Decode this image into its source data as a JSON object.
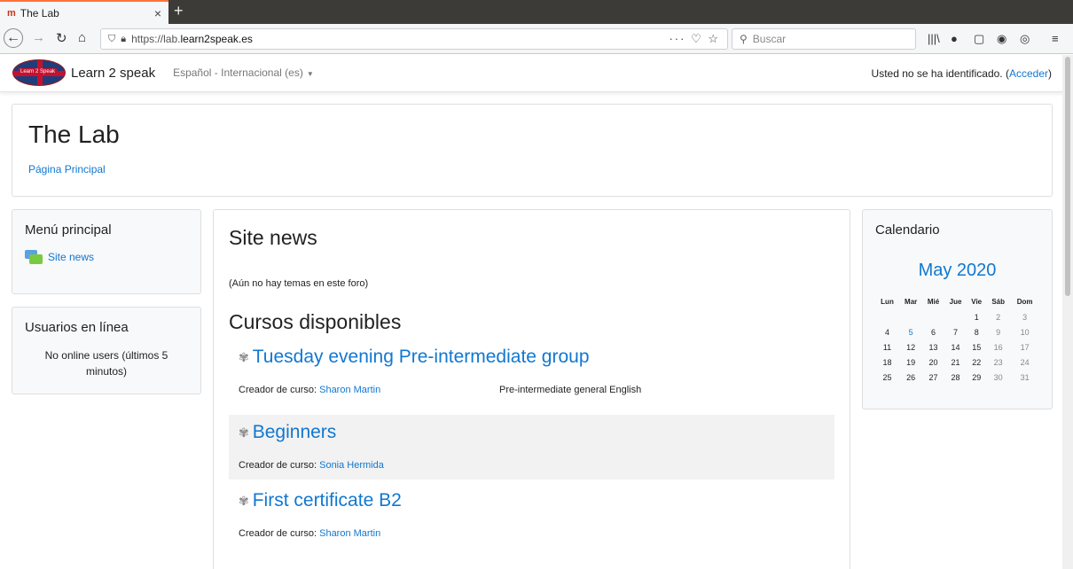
{
  "browser": {
    "tab_title": "The Lab",
    "tab_favicon": "m",
    "url_prefix": "https://lab.",
    "url_host": "learn2speak",
    "url_suffix": ".es",
    "search_placeholder": "Buscar"
  },
  "site": {
    "logo_text": "Learn 2 Speak",
    "brand": "Learn 2 speak",
    "language": "Español - Internacional (es)",
    "login_text": "Usted no se ha identificado. (",
    "login_link": "Acceder",
    "login_close": ")"
  },
  "page": {
    "title": "The Lab",
    "breadcrumb": "Página Principal"
  },
  "menu_block": {
    "title": "Menú principal",
    "item": "Site news"
  },
  "online_block": {
    "title": "Usuarios en línea",
    "text": "No online users (últimos 5 minutos)"
  },
  "main": {
    "news_title": "Site news",
    "no_topics": "(Aún no hay temas en este foro)",
    "courses_title": "Cursos disponibles",
    "creator_label": "Creador de curso: ",
    "courses": [
      {
        "name": "Tuesday evening Pre-intermediate group",
        "creator": "Sharon Martin",
        "summary": "Pre-intermediate general English"
      },
      {
        "name": "Beginners",
        "creator": "Sonia Hermida",
        "summary": ""
      },
      {
        "name": "First certificate B2",
        "creator": "Sharon Martin",
        "summary": ""
      }
    ]
  },
  "calendar": {
    "title": "Calendario",
    "month": "May 2020",
    "days": [
      "Lun",
      "Mar",
      "Mié",
      "Jue",
      "Vie",
      "Sáb",
      "Dom"
    ],
    "weeks": [
      [
        "",
        "",
        "",
        "",
        "1",
        "2",
        "3"
      ],
      [
        "4",
        "5",
        "6",
        "7",
        "8",
        "9",
        "10"
      ],
      [
        "11",
        "12",
        "13",
        "14",
        "15",
        "16",
        "17"
      ],
      [
        "18",
        "19",
        "20",
        "21",
        "22",
        "23",
        "24"
      ],
      [
        "25",
        "26",
        "27",
        "28",
        "29",
        "30",
        "31"
      ]
    ],
    "event_day": "5"
  },
  "colors": {
    "link": "#1177d1",
    "tab_accent": "#ff7139"
  }
}
